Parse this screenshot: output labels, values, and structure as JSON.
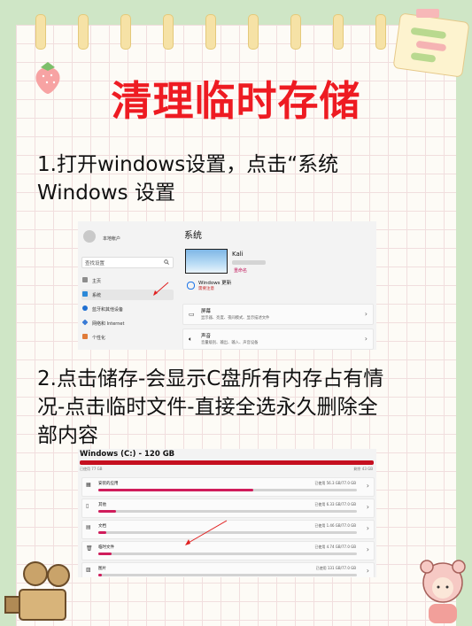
{
  "title": "清理临时存储",
  "step1": {
    "line1": "1.打开windows设置，点击“系统",
    "line2": "Windows 设置"
  },
  "step2": {
    "line1": "2.点击储存-会显示C盘所有内存占有情",
    "line2": "况-点击临时文件-直接全选永久删除全",
    "line3": "部内容"
  },
  "settings": {
    "account": "本地帐户",
    "search_placeholder": "查找设置",
    "nav": [
      {
        "label": "主页",
        "icon": "home-icon",
        "active": false
      },
      {
        "label": "系统",
        "icon": "system-icon",
        "active": true
      },
      {
        "label": "蓝牙和其他设备",
        "icon": "bluetooth-icon",
        "active": false
      },
      {
        "label": "网络和 Internet",
        "icon": "network-icon",
        "active": false
      },
      {
        "label": "个性化",
        "icon": "personalization-icon",
        "active": false
      }
    ],
    "page_title": "系统",
    "pc_name": "Kali",
    "rename": "重命名",
    "update_title": "Windows 更新",
    "update_status": "需要注意",
    "cards": [
      {
        "title": "屏幕",
        "desc": "显示器、亮度、夜间模式、显示描述文件",
        "icon": "display-icon"
      },
      {
        "title": "声音",
        "desc": "音量级别、输出、输入、声音设备",
        "icon": "sound-icon"
      }
    ]
  },
  "storage": {
    "drive_title": "Windows (C:) - 120 GB",
    "used": "已使用 77 GB",
    "free": "剩余 43 GB",
    "rows": [
      {
        "name": "安装的应用",
        "usage": "已使用 56.3 GB/77.0 GB",
        "fraction": 0.6,
        "icon": "apps-icon"
      },
      {
        "name": "其他",
        "usage": "已使用 6.33 GB/77.0 GB",
        "fraction": 0.07,
        "icon": "other-icon"
      },
      {
        "name": "文档",
        "usage": "已使用 1.46 GB/77.0 GB",
        "fraction": 0.03,
        "icon": "document-icon"
      },
      {
        "name": "临时文件",
        "usage": "已使用 4.74 GB/77.0 GB",
        "fraction": 0.05,
        "icon": "trash-icon"
      },
      {
        "name": "图片",
        "usage": "已使用 131 GB/77.0 GB",
        "fraction": 0.015,
        "icon": "picture-icon"
      }
    ]
  },
  "colors": {
    "title": "#ee1b22",
    "accent_bar": "#d01c5b",
    "drive_bar": "#c50f1f",
    "background": "#cfe6c6"
  }
}
